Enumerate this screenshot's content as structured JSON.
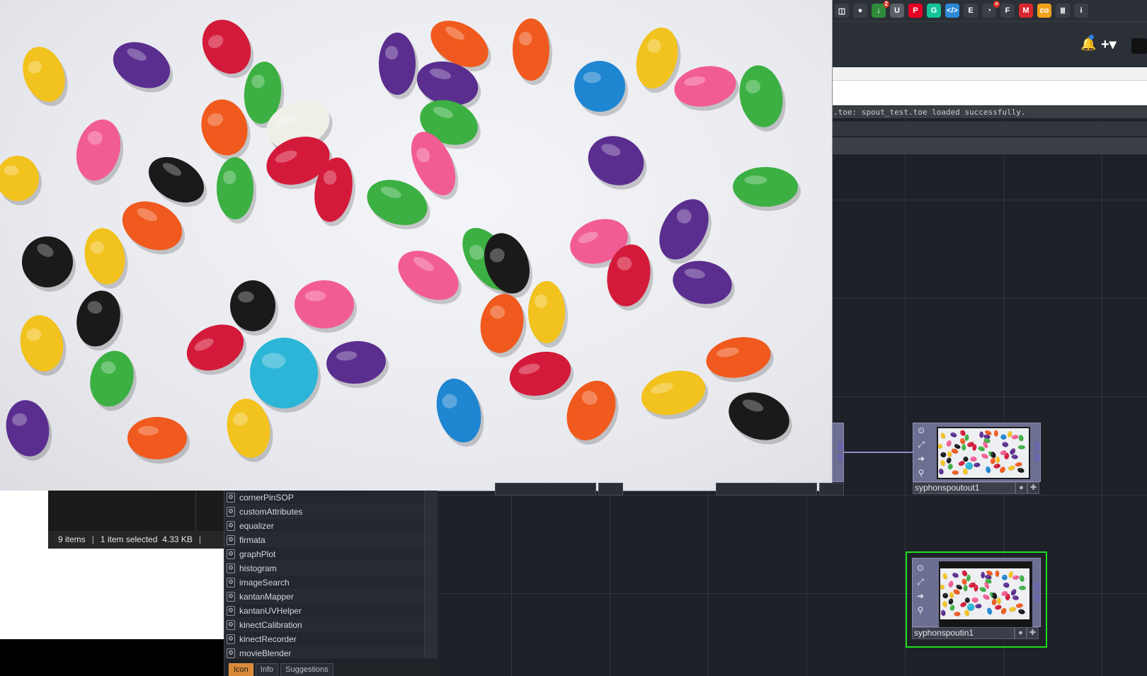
{
  "browser": {
    "extensions": [
      {
        "name": "reader-icon",
        "glyph": "◫",
        "color": "#3a3e46"
      },
      {
        "name": "account-icon",
        "glyph": "●",
        "color": "#3a3e46"
      },
      {
        "name": "download-icon",
        "glyph": "↓",
        "color": "#2e8b3a",
        "badge": "2"
      },
      {
        "name": "bitwarden-icon",
        "glyph": "U",
        "color": "#5a5f68"
      },
      {
        "name": "pinterest-icon",
        "glyph": "P",
        "color": "#e60023"
      },
      {
        "name": "grammarly-icon",
        "glyph": "G",
        "color": "#15c39a"
      },
      {
        "name": "code-icon",
        "glyph": "</>",
        "color": "#2d89d6"
      },
      {
        "name": "evernote-icon",
        "glyph": "E",
        "color": "#3a3e46"
      },
      {
        "name": "timer-icon",
        "glyph": "◔",
        "color": "#3a3e46",
        "badge": "×"
      },
      {
        "name": "fox-icon",
        "glyph": "F",
        "color": "#3a3e46"
      },
      {
        "name": "mega-icon",
        "glyph": "M",
        "color": "#d9272e"
      },
      {
        "name": "co-icon",
        "glyph": "co",
        "color": "#f0a21c"
      },
      {
        "name": "piano-icon",
        "glyph": "Ⅲ",
        "color": "#3a3e46"
      },
      {
        "name": "info-icon",
        "glyph": "i",
        "color": "#3a3e46"
      }
    ],
    "plus_label": "+▾"
  },
  "textport": {
    "status_message": ".toe: spout_test.toe loaded successfully."
  },
  "explorer": {
    "item_count": "9 items",
    "selection": "1 item selected",
    "size": "4.33 KB"
  },
  "palette": {
    "items": [
      "cornerPinSOP",
      "customAttributes",
      "equalizer",
      "firmata",
      "graphPlot",
      "histogram",
      "imageSearch",
      "kantanMapper",
      "kantanUVHelper",
      "kinectCalibration",
      "kinectRecorder",
      "movieBlender"
    ],
    "tabs": [
      {
        "label": "Icon",
        "active": true
      },
      {
        "label": "Info",
        "active": false
      },
      {
        "label": "Suggestions",
        "active": false
      }
    ]
  },
  "nodes": [
    {
      "name": "syphonspoutout1",
      "selected": false
    },
    {
      "name": "syphonspoutin1",
      "selected": true
    }
  ],
  "colors": {
    "selection_green": "#1ee01e",
    "palette_active_tab": "#d98a38",
    "node_body": "#6d6f92"
  }
}
